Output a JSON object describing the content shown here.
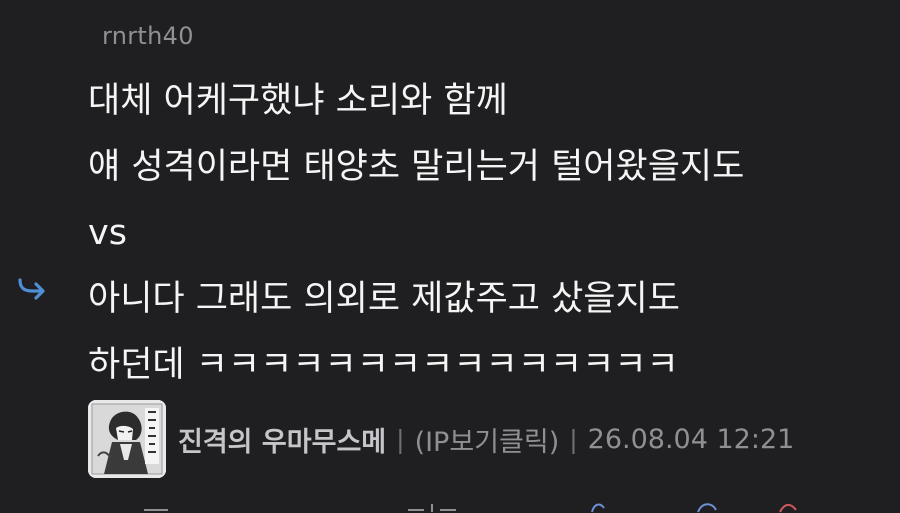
{
  "comment": {
    "username": "rnrth40",
    "lines": [
      "대체 어케구했냐 소리와 함께",
      "얘 성격이라면 태양초 말리는거 털어왔을지도",
      "vs",
      "아니다 그래도 의외로 제값주고 샀을지도",
      "하던데 ㅋㅋㅋㅋㅋㅋㅋㅋㅋㅋㅋㅋㅋㅋㅋ"
    ],
    "author": {
      "nickname": "진격의 우마무스메",
      "ip_link": "(IP보기클릭)",
      "date": "26.08.04 12:21",
      "separator": "|"
    },
    "reply_icon": "reply-arrow-icon",
    "avatar_icon": "manga-character-avatar"
  },
  "colors": {
    "background": "#1f1f21",
    "text": "#f5f5f5",
    "muted": "#8f8f94",
    "nickname": "#c5c5ca",
    "reply_arrow": "#4f8fd6"
  }
}
